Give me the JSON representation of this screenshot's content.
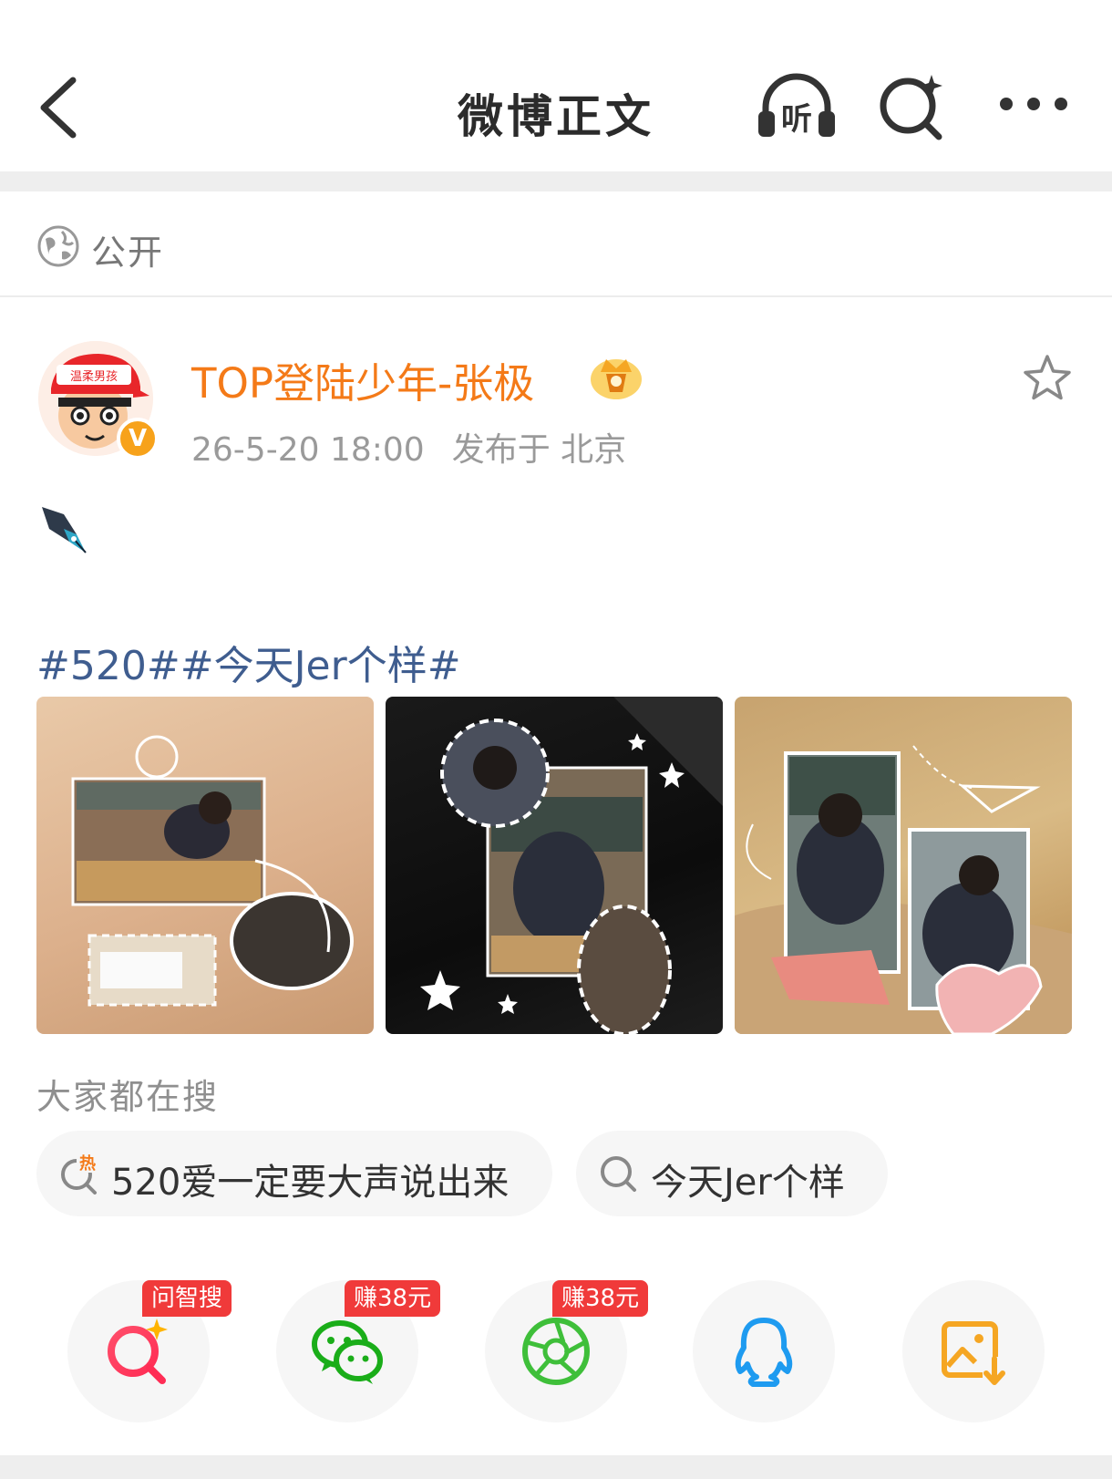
{
  "header": {
    "title": "微博正文",
    "listen_glyph": "听"
  },
  "visibility": {
    "label": "公开"
  },
  "post": {
    "author": "TOP登陆少年-张极",
    "avatar_cap_text": "温柔男孩",
    "verified_mark": "V",
    "time": "26-5-20 18:00",
    "location": "发布于 北京",
    "hashtags": [
      "#520#",
      "#今天Jer个样#"
    ]
  },
  "trending": {
    "heading": "大家都在搜",
    "hot_mark": "热",
    "chips": [
      {
        "label": "520爱一定要大声说出来"
      },
      {
        "label": "今天Jer个样"
      }
    ]
  },
  "share": {
    "badges": [
      "问智搜",
      "赚38元",
      "赚38元"
    ],
    "icons": [
      "ai-search-icon",
      "wechat-icon",
      "moments-icon",
      "qq-icon",
      "save-image-icon"
    ]
  },
  "colors": {
    "author": "#f47a18",
    "hashtag": "#3f5d8f",
    "badge": "#f03a3a",
    "wechat": "#1aad19",
    "qq": "#1e9bf0",
    "save": "#f5a623"
  }
}
